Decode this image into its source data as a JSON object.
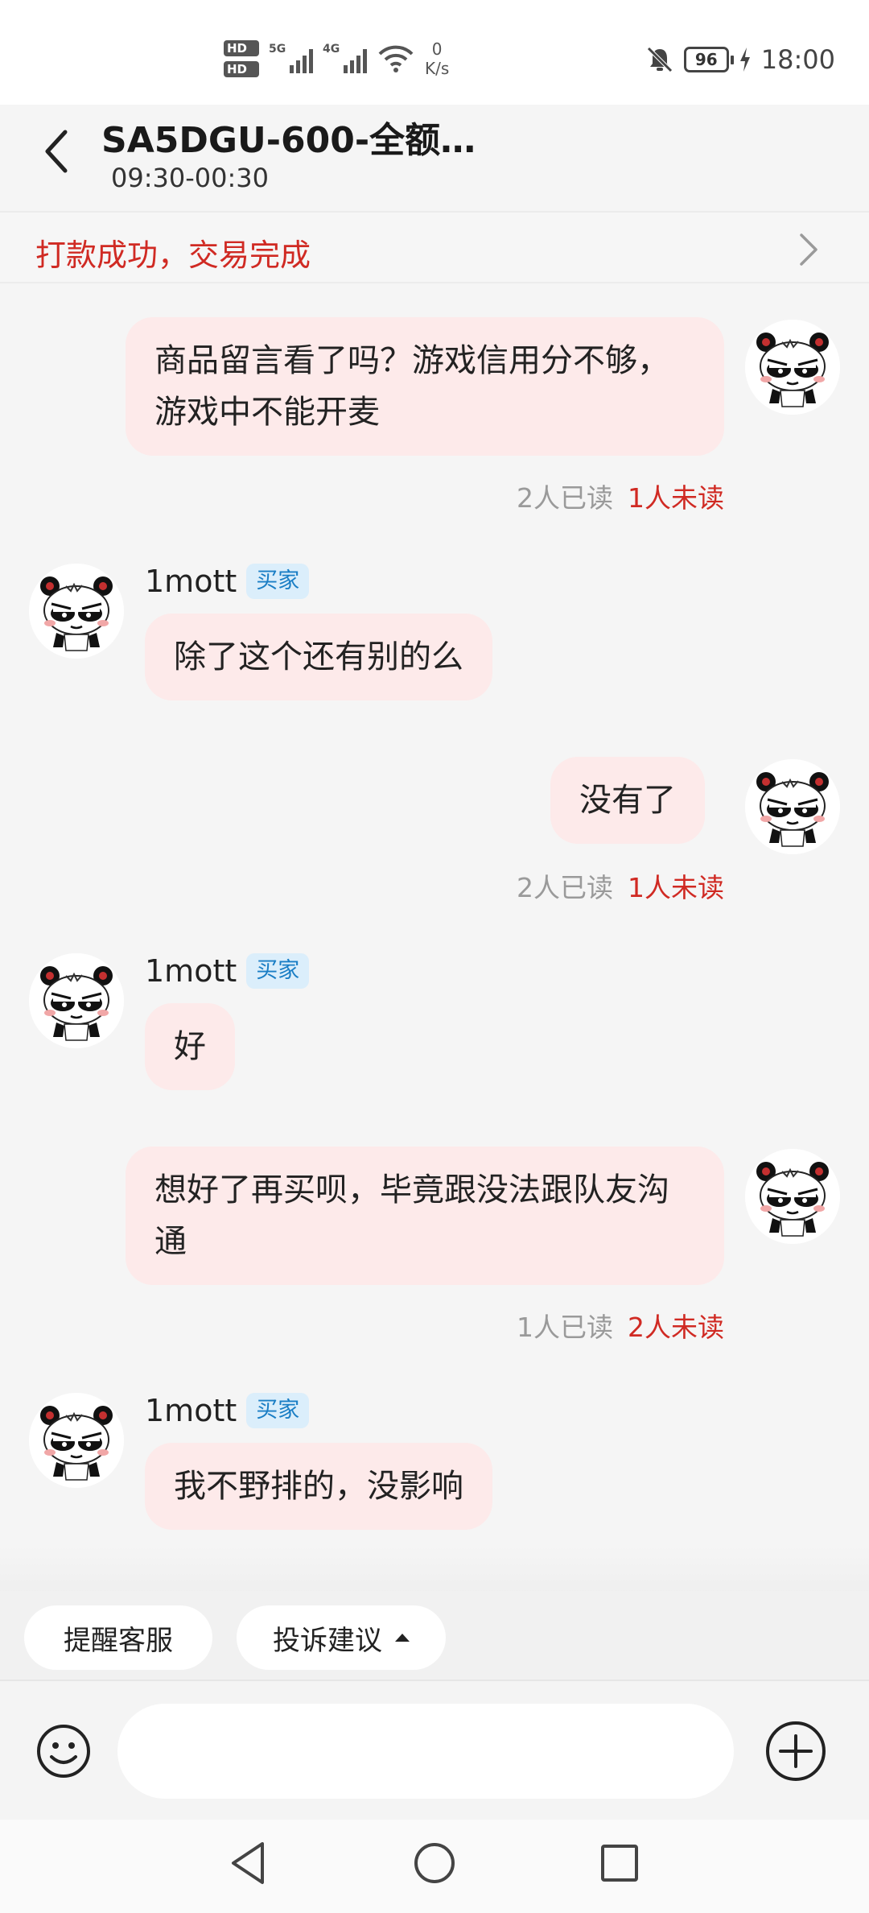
{
  "status_bar": {
    "hd1": "HD",
    "hd2": "HD",
    "net1": "5G",
    "net2": "4G",
    "speed_value": "0",
    "speed_unit": "K/s",
    "battery": "96",
    "time": "18:00",
    "icons": [
      "hd-icon",
      "signal-icon",
      "wifi-icon",
      "mute-icon",
      "battery-icon",
      "charging-icon"
    ]
  },
  "header": {
    "title": "SA5DGU-600-全额…",
    "subtitle": "09:30-00:30"
  },
  "notice": {
    "text": "打款成功，交易完成"
  },
  "messages": [
    {
      "side": "self",
      "text": "商品留言看了吗？游戏信用分不够，游戏中不能开麦",
      "read": "2人已读",
      "unread": "1人未读"
    },
    {
      "side": "other",
      "sender": "1mott",
      "role": "买家",
      "text": "除了这个还有别的么"
    },
    {
      "side": "self",
      "text": "没有了",
      "read": "2人已读",
      "unread": "1人未读"
    },
    {
      "side": "other",
      "sender": "1mott",
      "role": "买家",
      "text": "好"
    },
    {
      "side": "self",
      "text": "想好了再买呗，毕竟跟没法跟队友沟通",
      "read": "1人已读",
      "unread": "2人未读"
    },
    {
      "side": "other",
      "sender": "1mott",
      "role": "买家",
      "text": "我不野排的，没影响"
    }
  ],
  "quick_actions": {
    "remind": "提醒客服",
    "complaint": "投诉建议"
  },
  "input": {
    "placeholder": ""
  },
  "colors": {
    "accent_red": "#d02a23",
    "bubble": "#fdeaea",
    "role_tag_bg": "#dbeefb",
    "role_tag_text": "#1a7ec5"
  }
}
